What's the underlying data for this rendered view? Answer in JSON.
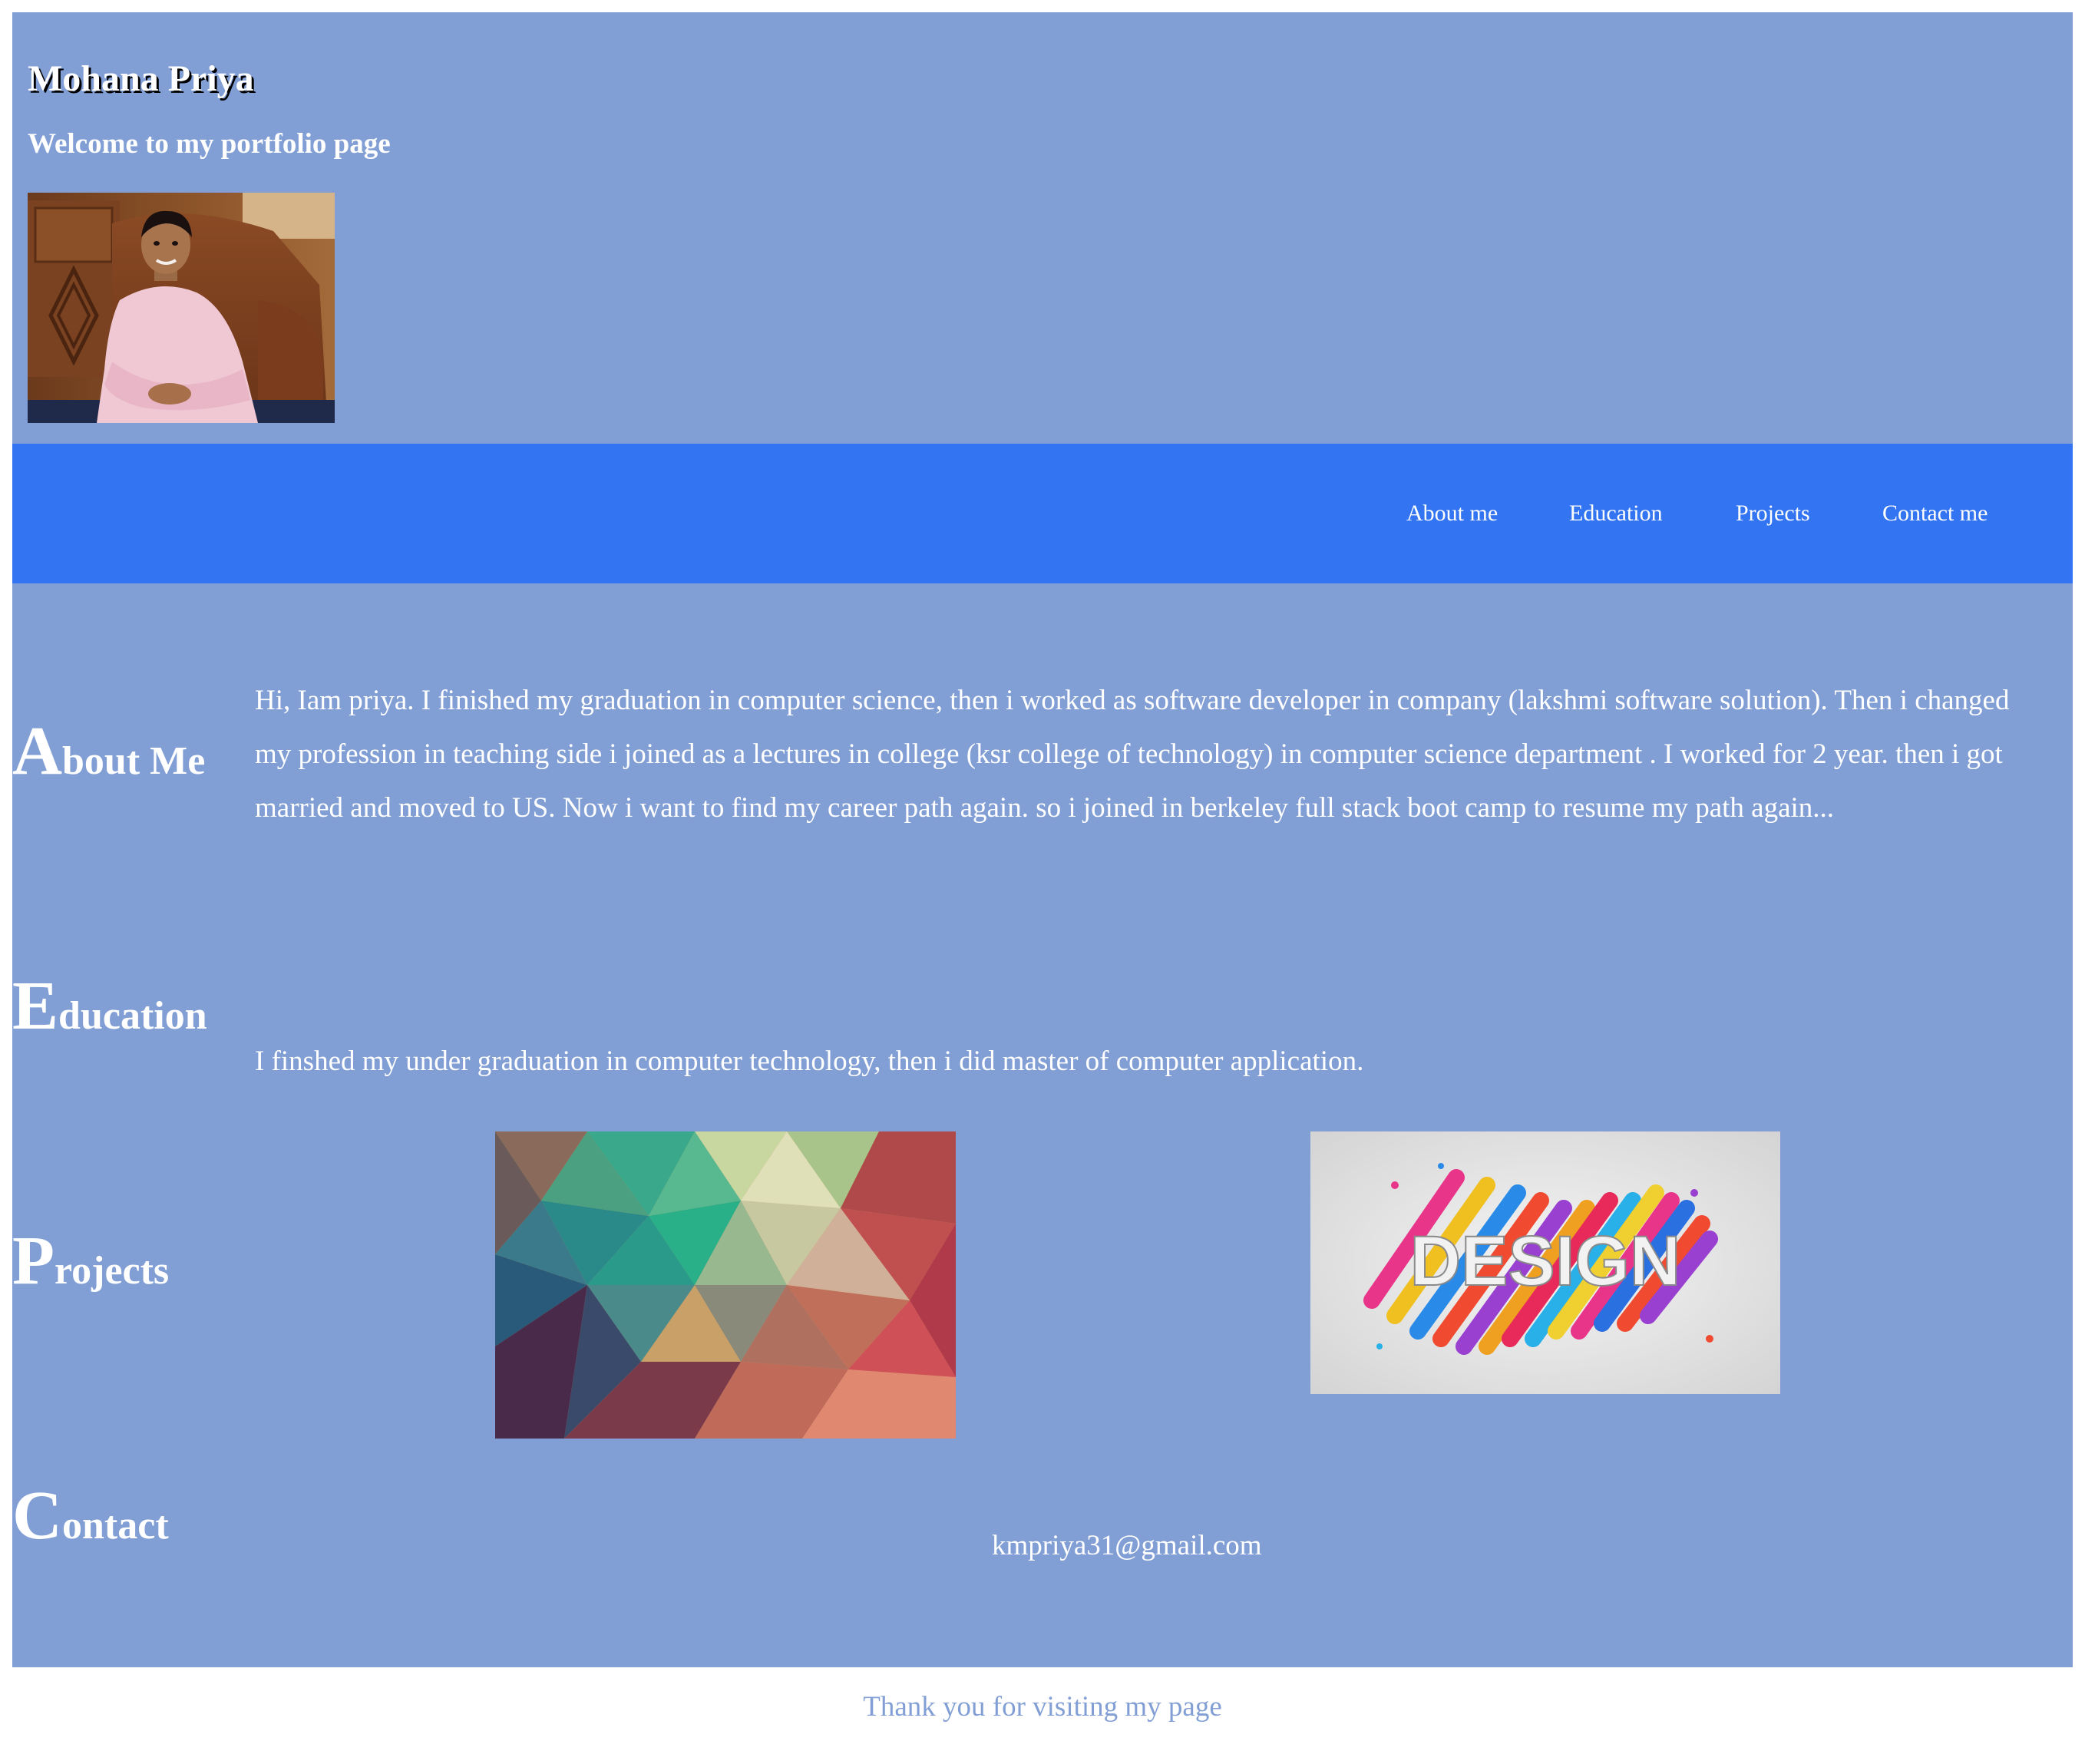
{
  "header": {
    "title": "Mohana Priya",
    "subtitle": "Welcome to my portfolio page"
  },
  "nav": {
    "items": [
      {
        "label": "About me"
      },
      {
        "label": "Education"
      },
      {
        "label": "Projects"
      },
      {
        "label": "Contact me"
      }
    ]
  },
  "about": {
    "heading_cap": "A",
    "heading_rest": "bout Me",
    "text": "Hi, Iam priya. I finished my graduation in computer science, then i worked as software developer in company (lakshmi software solution). Then i changed my profession in teaching side i joined as a lectures in college (ksr college of technology) in computer science department . I worked for 2 year. then i got married and moved to US. Now i want to find my career path again. so i joined in berkeley full stack boot camp to resume my path again..."
  },
  "education": {
    "heading_cap": "E",
    "heading_rest": "ducation",
    "text": "I finshed my under graduation in computer technology, then i did master of computer application."
  },
  "projects": {
    "heading_cap": "P",
    "heading_rest": "rojects",
    "images": [
      {
        "icon": "polygon-art-image"
      },
      {
        "icon": "design-logo-image",
        "label": "DESIGN"
      }
    ]
  },
  "contact": {
    "heading_cap": "C",
    "heading_rest": "ontact",
    "email": "kmpriya31@gmail.com"
  },
  "footer": {
    "text": "Thank you for visiting my page"
  },
  "colors": {
    "page_bg": "#829fd5",
    "nav_bg": "#3274f2",
    "text": "#ffffff",
    "footer_text": "#829fd5"
  }
}
